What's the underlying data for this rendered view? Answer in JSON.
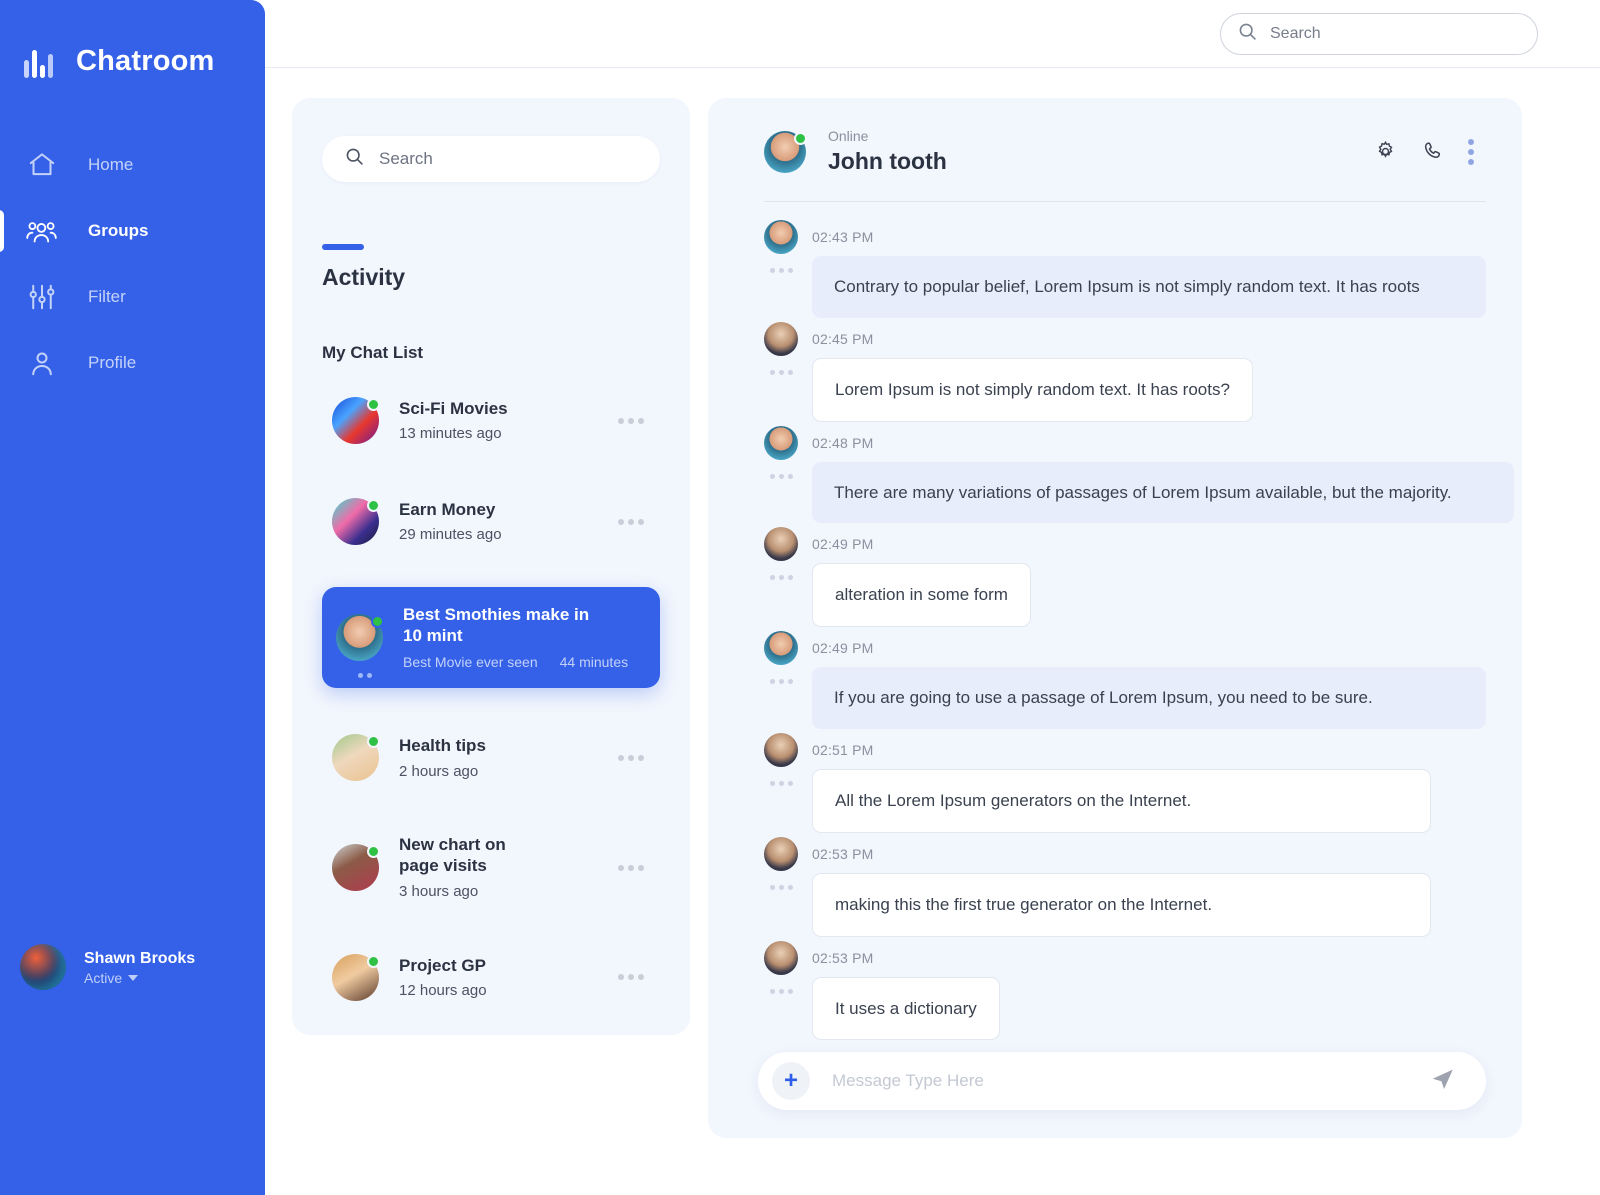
{
  "theme": {
    "brand_blue": "#3461e8",
    "panel_bg": "#f2f6fd",
    "bubble_tint": "#e7edfb",
    "online_green": "#2fc143"
  },
  "sidebar": {
    "brand_title": "Chatroom",
    "items": [
      {
        "label": "Home",
        "icon": "home-icon",
        "active": false
      },
      {
        "label": "Groups",
        "icon": "groups-icon",
        "active": true
      },
      {
        "label": "Filter",
        "icon": "filter-icon",
        "active": false
      },
      {
        "label": "Profile",
        "icon": "profile-icon",
        "active": false
      }
    ],
    "user": {
      "name": "Shawn Brooks",
      "status": "Active"
    }
  },
  "topbar": {
    "search": {
      "placeholder": "Search",
      "value": "",
      "icon": "search-icon"
    }
  },
  "list_panel": {
    "search": {
      "placeholder": "Search",
      "value": "",
      "icon": "search-icon"
    },
    "activity_label": "Activity",
    "chat_list_label": "My Chat List",
    "chats": [
      {
        "name": "Sci-Fi Movies",
        "time": "13 minutes ago",
        "online": true,
        "selected": false
      },
      {
        "name": "Earn Money",
        "time": "29 minutes ago",
        "online": true,
        "selected": false
      },
      {
        "name": "Best Smothies make in 10 mint",
        "subtitle": "Best Movie ever seen",
        "time": "44 minutes",
        "online": true,
        "selected": true
      },
      {
        "name": "Health tips",
        "time": "2 hours ago",
        "online": true,
        "selected": false
      },
      {
        "name": "New chart on page visits",
        "time": "3 hours ago",
        "online": true,
        "selected": false
      },
      {
        "name": "Project GP",
        "time": "12 hours ago",
        "online": true,
        "selected": false
      }
    ]
  },
  "conversation": {
    "header": {
      "status": "Online",
      "name": "John tooth",
      "actions": [
        "gear-icon",
        "phone-icon",
        "more-vertical-icon"
      ]
    },
    "messages": [
      {
        "time": "02:43 PM",
        "text": "Contrary to popular belief, Lorem Ipsum is not simply random text. It has roots",
        "style": "tint",
        "width": "full",
        "sender": "him"
      },
      {
        "time": "02:45 PM",
        "text": "Lorem Ipsum is not simply random text. It has roots?",
        "style": "plain",
        "width": "auto",
        "sender": "her"
      },
      {
        "time": "02:48 PM",
        "text": "There are many variations of passages of Lorem Ipsum available, but the majority.",
        "style": "tint",
        "width": "full",
        "sender": "him"
      },
      {
        "time": "02:49 PM",
        "text": "alteration in some form",
        "style": "plain",
        "width": "auto",
        "sender": "her"
      },
      {
        "time": "02:49 PM",
        "text": "If you are going to use a passage of Lorem Ipsum, you need to be sure.",
        "style": "tint",
        "width": "full",
        "sender": "him"
      },
      {
        "time": "02:51 PM",
        "text": "All the Lorem Ipsum generators on the Internet.",
        "style": "plain",
        "width": "full",
        "sender": "her"
      },
      {
        "time": "02:53 PM",
        "text": "making this the first true generator on the Internet.",
        "style": "plain",
        "width": "full",
        "sender": "her"
      },
      {
        "time": "02:53 PM",
        "text": "It uses a dictionary",
        "style": "plain",
        "width": "auto",
        "sender": "her"
      }
    ],
    "composer": {
      "placeholder": "Message Type Here",
      "value": "",
      "add_label": "+",
      "send_icon": "send-icon"
    }
  }
}
